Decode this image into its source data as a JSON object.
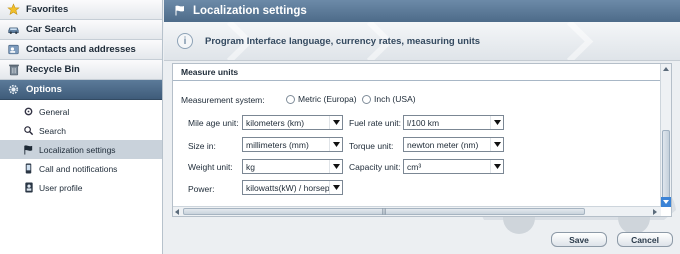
{
  "sidebar": {
    "items": [
      {
        "label": "Favorites",
        "icon": "star-icon"
      },
      {
        "label": "Car Search",
        "icon": "car-icon"
      },
      {
        "label": "Contacts and addresses",
        "icon": "contacts-icon"
      },
      {
        "label": "Recycle Bin",
        "icon": "trash-icon"
      },
      {
        "label": "Options",
        "icon": "gear-icon"
      }
    ],
    "subitems": [
      {
        "label": "General",
        "icon": "wrench-icon"
      },
      {
        "label": "Search",
        "icon": "magnifier-icon"
      },
      {
        "label": "Localization settings",
        "icon": "flag-icon"
      },
      {
        "label": "Call and notifications",
        "icon": "phone-icon"
      },
      {
        "label": "User profile",
        "icon": "user-icon"
      }
    ],
    "selected_subitem": "Localization settings"
  },
  "header": {
    "title": "Localization settings",
    "info_text": "Program Interface language, currency rates, measuring units"
  },
  "measure": {
    "section_title": "Measure units",
    "system_label": "Measurement system:",
    "system_options": [
      "Metric (Europa)",
      "Inch (USA)"
    ],
    "mileage_label": "Mile age unit:",
    "mileage_value": "kilometers (km)",
    "size_label": "Size in:",
    "size_value": "millimeters (mm)",
    "weight_label": "Weight unit:",
    "weight_value": "kg",
    "power_label": "Power:",
    "power_value": "kilowatts(kW) / horsepo",
    "fuel_label": "Fuel rate unit:",
    "fuel_value": "l/100 km",
    "torque_label": "Torque unit:",
    "torque_value": "newton meter (nm)",
    "capacity_label": "Capacity unit:",
    "capacity_value": "cm³"
  },
  "buttons": {
    "save": "Save",
    "cancel": "Cancel"
  },
  "colors": {
    "accent": "#4d6b89",
    "selected": "#c9d2db",
    "scroll_button": "#3b83d6"
  }
}
